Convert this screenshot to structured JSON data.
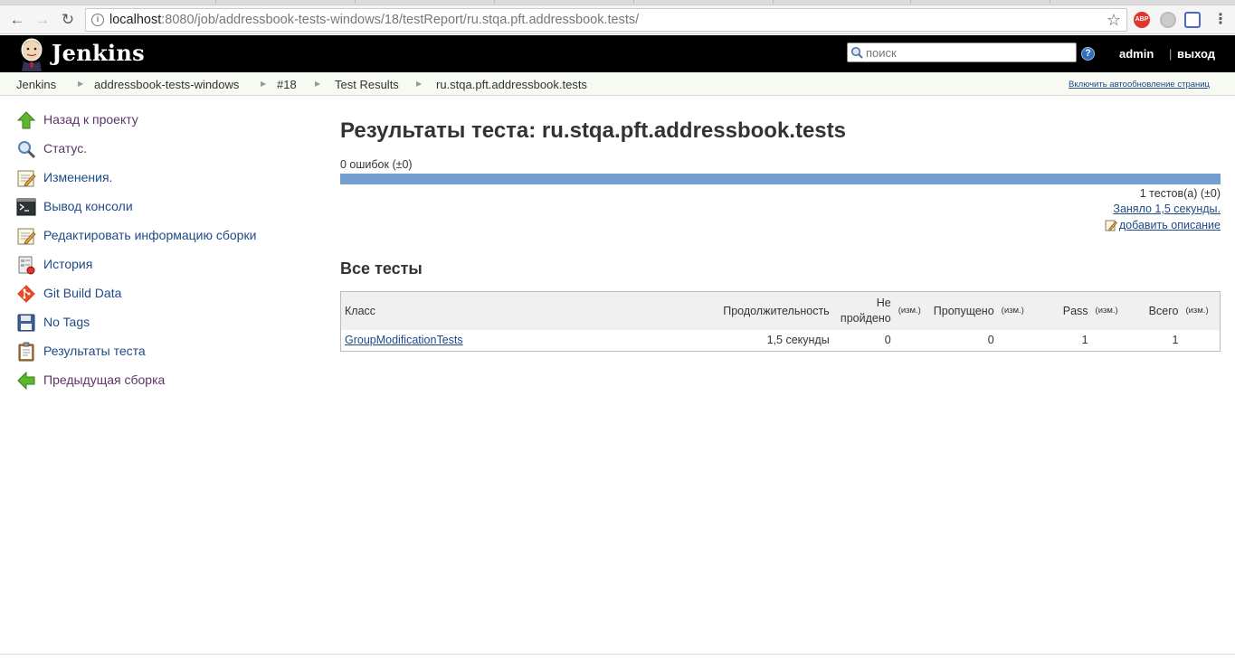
{
  "browser": {
    "url_host": "localhost",
    "url_rest": ":8080/job/addressbook-tests-windows/18/testReport/ru.stqa.pft.addressbook.tests/",
    "abp_label": "ABP"
  },
  "header": {
    "logo_text": "Jenkins",
    "search_placeholder": "поиск",
    "help_label": "?",
    "user": "admin",
    "logout_separator": "|",
    "logout": "выход"
  },
  "breadcrumbs": {
    "items": [
      "Jenkins",
      "addressbook-tests-windows",
      "#18",
      "Test Results",
      "ru.stqa.pft.addressbook.tests"
    ],
    "autorefresh": "Включить автообновление страниц"
  },
  "sidebar": {
    "items": [
      {
        "label": "Назад к проекту",
        "icon": "up-arrow-icon"
      },
      {
        "label": "Статус.",
        "icon": "magnifier-icon"
      },
      {
        "label": "Изменения.",
        "icon": "notepad-icon"
      },
      {
        "label": "Вывод консоли",
        "icon": "terminal-icon"
      },
      {
        "label": "Редактировать информацию сборки",
        "icon": "notepad-icon"
      },
      {
        "label": "История",
        "icon": "history-icon"
      },
      {
        "label": "Git Build Data",
        "icon": "git-icon"
      },
      {
        "label": "No Tags",
        "icon": "floppy-disk-icon"
      },
      {
        "label": "Результаты теста",
        "icon": "clipboard-icon"
      },
      {
        "label": "Предыдущая сборка",
        "icon": "left-arrow-icon"
      }
    ]
  },
  "main": {
    "title": "Результаты теста: ru.stqa.pft.addressbook.tests",
    "fail_count": "0 ошибок (±0)",
    "pass_fraction": 1.0,
    "tests_count": "1 тестов(а) (±0)",
    "took": "Заняло 1,5 секунды.",
    "add_description": "добавить описание",
    "section_title": "Все тесты",
    "table": {
      "headers": {
        "class": "Класс",
        "duration": "Продолжительность",
        "failed_line1": "Не",
        "failed_line2": "пройдено",
        "diff": "(изм.)",
        "skipped": "Пропущено",
        "pass": "Pass",
        "total": "Всего"
      },
      "rows": [
        {
          "class": "GroupModificationTests",
          "duration": "1,5 секунды",
          "failed": "0",
          "skipped": "0",
          "pass": "1",
          "total": "1"
        }
      ]
    }
  },
  "colors": {
    "result_bar": "#729fcf",
    "link": "#204a87",
    "visited_link": "#5c3566",
    "header_bg": "#000000"
  }
}
